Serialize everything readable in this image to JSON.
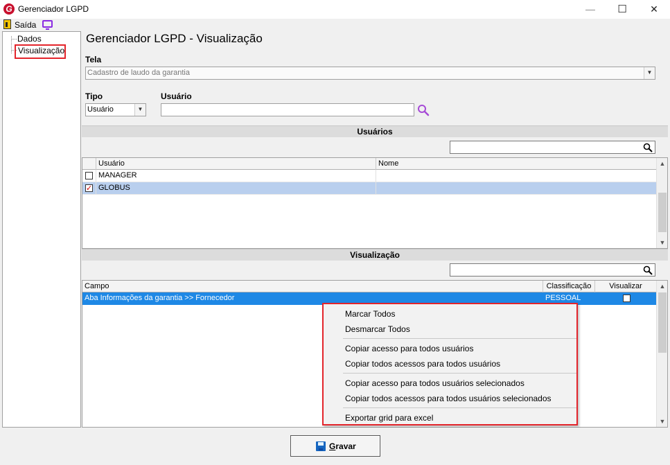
{
  "window": {
    "title": "Gerenciador LGPD",
    "app_icon_letter": "G",
    "minimize_glyph": "—",
    "maximize_glyph": "☐",
    "close_glyph": "✕"
  },
  "toolbar": {
    "exit_label": "Saída"
  },
  "tree": {
    "items": [
      {
        "label": "Dados"
      },
      {
        "label": "Visualização"
      }
    ]
  },
  "main": {
    "title": "Gerenciador LGPD - Visualização",
    "tela_label": "Tela",
    "tela_value": "Cadastro de laudo da garantia",
    "tipo_label": "Tipo",
    "tipo_value": "Usuário",
    "usuario_label": "Usuário",
    "usuario_value": ""
  },
  "users_section": {
    "header": "Usuários",
    "search_value": "",
    "columns": [
      "Usuário",
      "Nome"
    ],
    "rows": [
      {
        "usuario": "MANAGER",
        "nome": "",
        "checked": false
      },
      {
        "usuario": "GLOBUS",
        "nome": "",
        "checked": true
      }
    ]
  },
  "view_section": {
    "header": "Visualização",
    "search_value": "",
    "columns": [
      "Campo",
      "Classificação",
      "Visualizar"
    ],
    "rows": [
      {
        "campo": "Aba Informações da garantia >> Fornecedor",
        "classificacao": "PESSOAL",
        "visualizar": false
      }
    ]
  },
  "context_menu": {
    "items": [
      "Marcar Todos",
      "Desmarcar Todos",
      "Copiar acesso para todos usuários",
      "Copiar todos acessos para todos usuários",
      "Copiar acesso para todos usuários selecionados",
      "Copiar todos acessos para todos usuários selecionados",
      "Exportar grid para excel"
    ]
  },
  "footer": {
    "save_label_accel": "G",
    "save_label_rest": "ravar"
  },
  "colors": {
    "highlight_box": "#e3242b",
    "selected_row": "#b9cfee",
    "active_row": "#1e88e5",
    "brand_red": "#c8102e",
    "accent_purple": "#8a2be2"
  }
}
